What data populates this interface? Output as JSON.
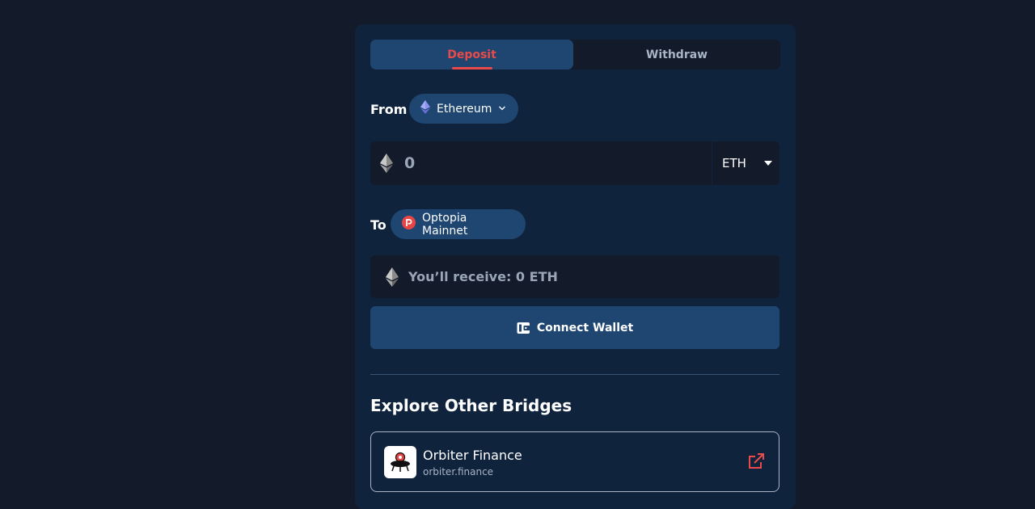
{
  "tabs": {
    "deposit": "Deposit",
    "withdraw": "Withdraw"
  },
  "from": {
    "label": "From",
    "network": "Ethereum"
  },
  "amount": {
    "placeholder": "0",
    "token": "ETH"
  },
  "to": {
    "label": "To",
    "network": "Optopia Mainnet"
  },
  "receive": {
    "text": "You’ll receive: 0 ETH"
  },
  "connect": {
    "label": "Connect Wallet"
  },
  "explore": {
    "title": "Explore Other Bridges",
    "bridges": [
      {
        "name": "Orbiter Finance",
        "url": "orbiter.finance"
      }
    ]
  },
  "colors": {
    "page_bg": "#131a2a",
    "panel_bg": "#0f233d",
    "accent": "#ea4a4a",
    "button_bg": "#1e4670",
    "eth_purple": "#627eea"
  },
  "icons": {
    "network": "ethereum-icon",
    "destination": "optopia-icon",
    "token": "eth-icon",
    "wallet": "wallet-icon",
    "external": "external-link-icon",
    "bridge_logo": "orbiter-logo-icon"
  }
}
